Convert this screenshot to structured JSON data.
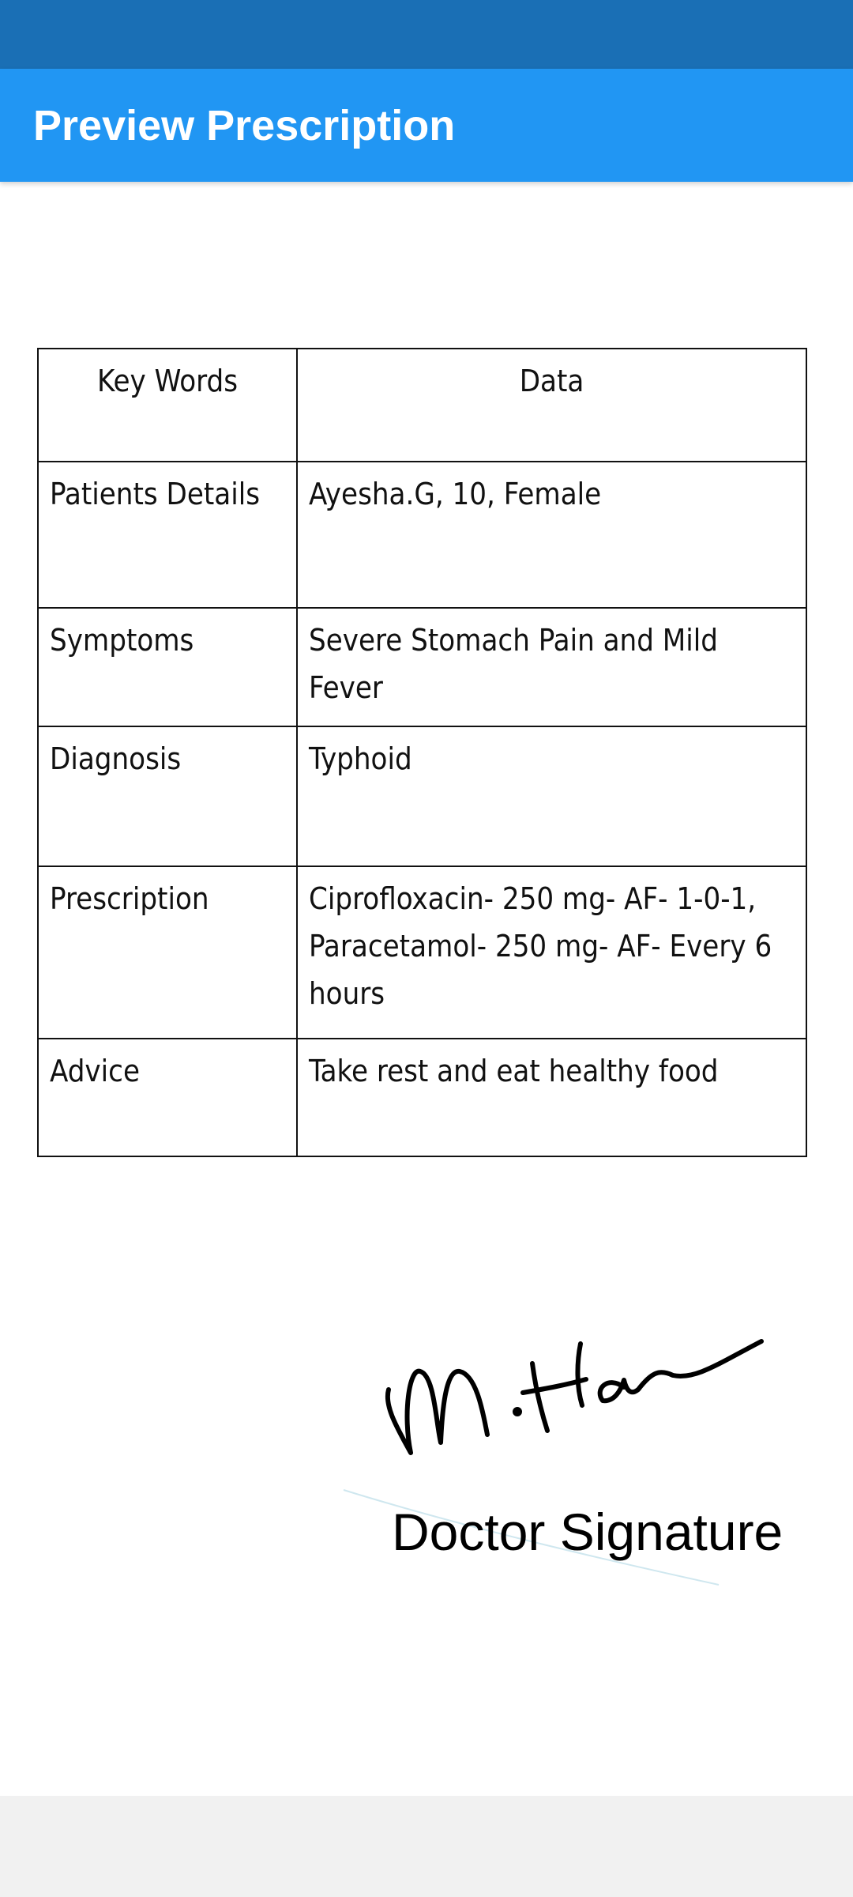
{
  "app_bar": {
    "title": "Preview Prescription"
  },
  "table": {
    "headers": {
      "key": "Key Words",
      "data": "Data"
    },
    "rows": [
      {
        "key": "Patients Details",
        "value": "Ayesha.G, 10, Female"
      },
      {
        "key": "Symptoms",
        "value": "Severe Stomach Pain and Mild Fever"
      },
      {
        "key": "Diagnosis",
        "value": "Typhoid"
      },
      {
        "key": "Prescription",
        "value_lines": [
          "Ciprofloxacin- 250 mg- AF- 1-0-1,",
          "Paracetamol- 250 mg- AF- Every 6",
          "hours"
        ]
      },
      {
        "key": "Advice",
        "value": "Take rest and eat healthy food"
      }
    ]
  },
  "signature": {
    "caption": "Doctor Signature",
    "handwriting": "M. Han"
  },
  "colors": {
    "app_bar": "#2196f3",
    "status_bar": "#1a6fb5",
    "nav_bar": "#f1f1f1"
  }
}
